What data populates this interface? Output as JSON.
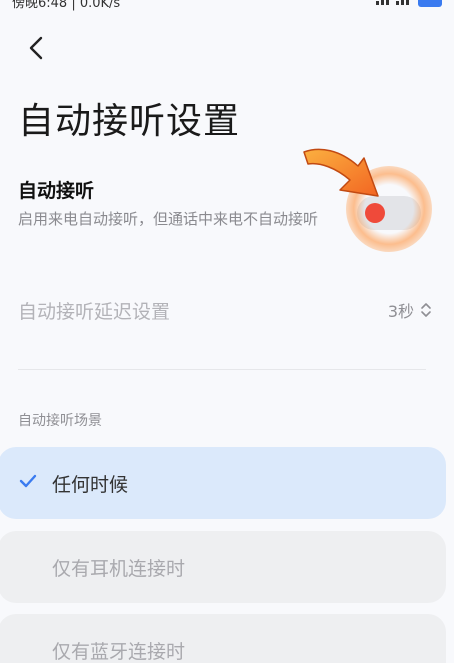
{
  "status_bar": {
    "time_text": "傍晚6:48 | 0.0K/s"
  },
  "header": {
    "title": "自动接听设置"
  },
  "auto_answer": {
    "title": "自动接听",
    "description": "启用来电自动接听，但通话中来电不自动接听",
    "enabled": false
  },
  "delay": {
    "label": "自动接听延迟设置",
    "value": "3秒"
  },
  "scenarios": {
    "section_label": "自动接听场景",
    "options": [
      {
        "label": "任何时候",
        "selected": true
      },
      {
        "label": "仅有耳机连接时",
        "selected": false
      },
      {
        "label": "仅有蓝牙连接时",
        "selected": false
      }
    ]
  },
  "colors": {
    "accent": "#3a7bf0",
    "selected_bg": "#dbe9fb",
    "toggle_knob": "#ef4a3a",
    "annotation": "#f7941d"
  },
  "icons": [
    "back-arrow-icon",
    "checkmark-icon",
    "up-down-chevron-icon",
    "battery-icon"
  ]
}
